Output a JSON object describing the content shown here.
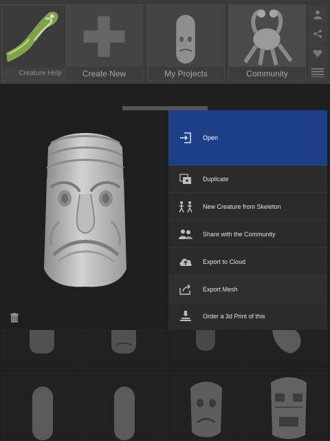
{
  "nav": {
    "tiles": [
      {
        "label": "Creature Help",
        "icon": "creature-help-thumbnail"
      },
      {
        "label": "Create New",
        "icon": "plus-icon"
      },
      {
        "label": "My Projects",
        "icon": "tiki-mask-thumbnail"
      },
      {
        "label": "Community",
        "icon": "creature-thumbnail"
      }
    ],
    "side_icons": [
      "user-icon",
      "share-icon",
      "heart-icon",
      "list-icon"
    ]
  },
  "preview": {
    "model": "tiki-mask-sculpt",
    "delete_icon": "trash-icon"
  },
  "menu": {
    "items": [
      {
        "label": "Open",
        "icon": "open-icon",
        "active": true
      },
      {
        "label": "Duplicate",
        "icon": "duplicate-icon"
      },
      {
        "label": "New Creature from Skeleton",
        "icon": "skeleton-icon"
      },
      {
        "label": "Share with the Community",
        "icon": "community-icon"
      },
      {
        "label": "Export to Cloud",
        "icon": "cloud-icon"
      },
      {
        "label": "Export Mesh",
        "icon": "export-mesh-icon"
      },
      {
        "label": "Order a 3d Print of this",
        "icon": "print-icon"
      }
    ]
  },
  "colors": {
    "accent": "#1d3f8a",
    "background": "#2e2e2e",
    "menu_text": "#e4e4e4"
  }
}
